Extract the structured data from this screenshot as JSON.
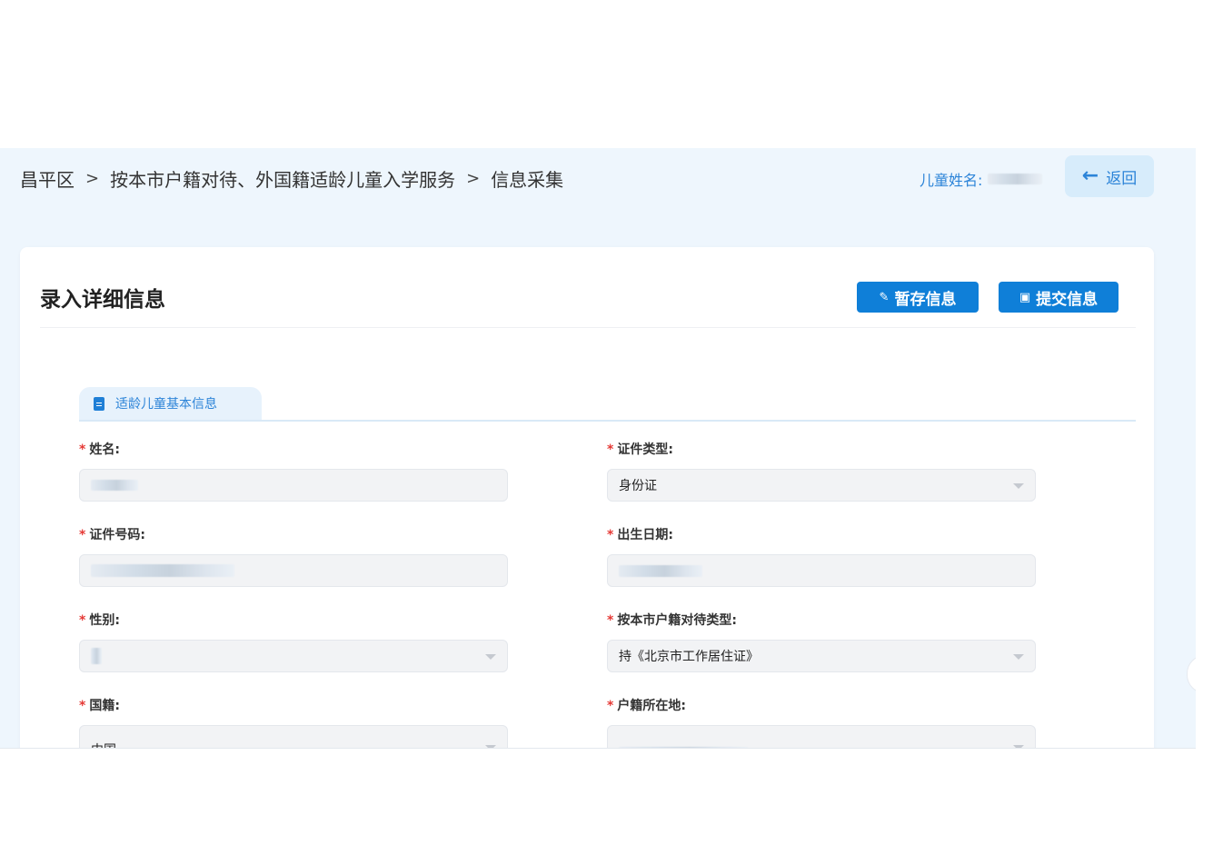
{
  "breadcrumb": {
    "items": [
      "昌平区",
      "按本市户籍对待、外国籍适龄儿童入学服务",
      "信息采集"
    ],
    "separator": ">"
  },
  "header": {
    "child_name_label": "儿童姓名:",
    "back_label": "返回"
  },
  "card": {
    "title": "录入详细信息",
    "save_label": "暂存信息",
    "submit_label": "提交信息"
  },
  "tab": {
    "label": "适龄儿童基本信息"
  },
  "form": {
    "required_mark": "*",
    "name_label": "姓名:",
    "id_type_label": "证件类型:",
    "id_type_value": "身份证",
    "id_number_label": "证件号码:",
    "birth_date_label": "出生日期:",
    "gender_label": "性别:",
    "treat_type_label": "按本市户籍对待类型:",
    "treat_type_value": "持《北京市工作居住证》",
    "nationality_label": "国籍:",
    "nationality_value": "中国",
    "household_label": "户籍所在地:"
  },
  "colors": {
    "accent": "#0f7fd8",
    "link": "#2c84d8",
    "required": "#e53935",
    "page_bg": "#eef6fd"
  },
  "icons": {
    "back": "arrow-left-icon",
    "save": "pencil-icon",
    "submit": "clipboard-icon",
    "tab": "document-icon",
    "select": "caret-down-icon"
  }
}
